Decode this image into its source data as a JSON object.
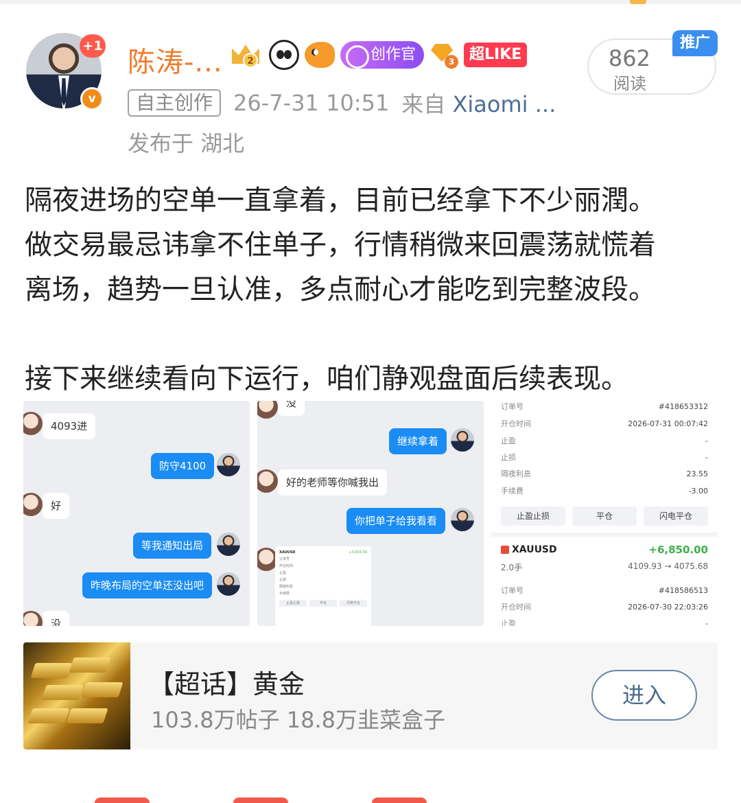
{
  "post": {
    "username": "陈涛-...",
    "plus_badge": "+1",
    "verify_mark": "v",
    "badges": {
      "crown_level": "2",
      "gem_level": "3",
      "creator_label": "创作官",
      "like_label": "超LIKE"
    },
    "tag": "自主创作",
    "timestamp": "26-7-31 10:51",
    "source_prefix": "来自",
    "source_device": "Xiaomi ...",
    "location": "发布于 湖北",
    "reads_count": "862",
    "reads_label": "阅读",
    "promo_label": "推广",
    "text_lines": [
      "隔夜进场的空单一直拿着，目前已经拿下不少丽潤。",
      "做交易最忌讳拿不住单子，行情稍微来回震荡就慌着",
      "离场，趋势一旦认准，多点耐心才能吃到完整波段。",
      "接下来继续看向下运行，咱们静观盘面后续表现。"
    ]
  },
  "chat1": {
    "msgs": [
      "4093进",
      "防守4100",
      "好",
      "等我通知出局",
      "昨晚布局的空单还没出吧",
      "没"
    ]
  },
  "chat2": {
    "msgs": [
      "没",
      "继续拿着",
      "好的老师等你喊我出",
      "你把单子给我看看"
    ],
    "mini_card": {
      "symbol": "XAUUSD",
      "pnl": "+3,601.00",
      "rows": [
        "订单号",
        "开仓时间",
        "止盈",
        "止损",
        "隔夜利息",
        "手续费"
      ],
      "btns": [
        "止盈止损",
        "平仓",
        "闪电平仓"
      ]
    }
  },
  "order": {
    "top_rows": [
      {
        "k": "订单号",
        "v": "#418653312"
      },
      {
        "k": "开仓时间",
        "v": "2026-07-31 00:07:42"
      },
      {
        "k": "止盈",
        "v": "-"
      },
      {
        "k": "止损",
        "v": "-"
      },
      {
        "k": "隔夜利息",
        "v": "23.55"
      },
      {
        "k": "手续费",
        "v": "-3.00"
      }
    ],
    "buttons": [
      "止盈止损",
      "平仓",
      "闪电平仓"
    ],
    "symbol": "XAUUSD",
    "pnl": "+6,850.00",
    "lots": "2.0手",
    "price_range": "4109.93 → 4075.68",
    "bottom_rows": [
      {
        "k": "订单号",
        "v": "#418586513"
      },
      {
        "k": "开仓时间",
        "v": "2026-07-30 22:03:26"
      },
      {
        "k": "止盈",
        "v": "-"
      }
    ]
  },
  "topic": {
    "title": "【超话】黄金",
    "stats": "103.8万帖子 18.8万韭菜盒子",
    "enter_label": "进入"
  },
  "colors": {
    "username": "#f07c2c",
    "link": "#4c6d95",
    "bubble_blue": "#1a8cf4",
    "profit_green": "#3fae4c",
    "promo_blue": "#3a8ef0"
  }
}
